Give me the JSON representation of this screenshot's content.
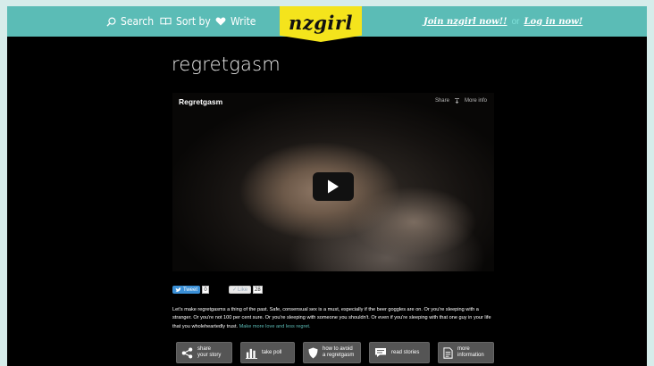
{
  "nav": {
    "search": "Search",
    "sort": "Sort by",
    "write": "Write"
  },
  "logo": "nzgirl",
  "auth": {
    "join": "Join nzgirl now!!",
    "or": "or",
    "login": "Log in now!"
  },
  "page_title": "regretgasm",
  "video": {
    "title": "Regretgasm",
    "share": "Share",
    "more_info": "More info"
  },
  "social": {
    "tweet_label": "Tweet",
    "tweet_count": "0",
    "like_label": "Like",
    "like_count": "28"
  },
  "description": {
    "text": "Let's make regretgasms a thing of the past. Safe, consensual sex is a must, especially if the beer goggles are on. Or you're sleeping with a stranger. Or you're not 100 per cent sure. Or you're sleeping with someone you shouldn't. Or even if you're sleeping with that one guy in your life that you wholeheartedly trust.",
    "link": "Make more love and less regret."
  },
  "actions": [
    {
      "line1": "share",
      "line2": "your story"
    },
    {
      "line1": "take poll",
      "line2": ""
    },
    {
      "line1": "how to avoid",
      "line2": "a regretgasm"
    },
    {
      "line1": "read stories",
      "line2": ""
    },
    {
      "line1": "more",
      "line2": "information"
    }
  ],
  "colors": {
    "topbar": "#5bbcb6",
    "logo_bg": "#f4e41c",
    "page_bg": "#000000",
    "outer_bg": "#d6ecea"
  }
}
